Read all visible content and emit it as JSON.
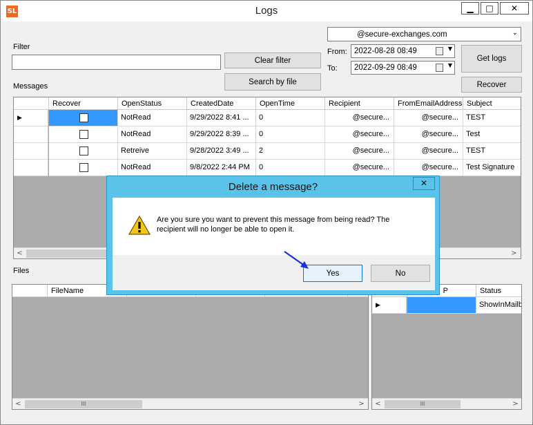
{
  "window": {
    "title": "Logs",
    "app_icon_text": "SL",
    "controls": {
      "minimize": "▁",
      "maximize": "□",
      "close": "✕"
    }
  },
  "filter": {
    "label": "Filter",
    "value": "",
    "clear_label": "Clear filter",
    "search_file_label": "Search by file"
  },
  "account": {
    "selected": "@secure-exchanges.com"
  },
  "dates": {
    "from_label": "From:",
    "from_value": "2022-08-28 08:49",
    "to_label": "To:",
    "to_value": "2022-09-29 08:49"
  },
  "actions": {
    "get_logs": "Get logs",
    "recover": "Recover"
  },
  "messages": {
    "label": "Messages",
    "columns": [
      "Recover",
      "OpenStatus",
      "CreatedDate",
      "OpenTime",
      "Recipient",
      "FromEmailAddress",
      "Subject"
    ],
    "rows": [
      {
        "current": true,
        "status": "NotRead",
        "created": "9/29/2022 8:41 ...",
        "opentime": "0",
        "recipient": "@secure...",
        "from": "@secure...",
        "subject": "TEST"
      },
      {
        "current": false,
        "status": "NotRead",
        "created": "9/29/2022 8:39 ...",
        "opentime": "0",
        "recipient": "@secure...",
        "from": "@secure...",
        "subject": "Test"
      },
      {
        "current": false,
        "status": "Retreive",
        "created": "9/28/2022 3:49 ...",
        "opentime": "2",
        "recipient": "@secure...",
        "from": "@secure...",
        "subject": "TEST"
      },
      {
        "current": false,
        "status": "NotRead",
        "created": "9/8/2022 2:44 PM",
        "opentime": "0",
        "recipient": "@secure...",
        "from": "@secure...",
        "subject": "Test Signature"
      }
    ]
  },
  "files": {
    "label": "Files",
    "columns": [
      "FileName"
    ]
  },
  "recipients": {
    "columns": [
      "P",
      "Status"
    ],
    "rows": [
      {
        "status": "ShowInMailb"
      }
    ]
  },
  "dialog": {
    "title": "Delete a message?",
    "close": "✕",
    "message": "Are you sure you want to prevent this message from being read? The recipient will no longer be able to open it.",
    "yes": "Yes",
    "no": "No"
  },
  "scrollbar": {
    "left": "<",
    "right": ">",
    "grip": "III"
  },
  "colors": {
    "dialog_frame": "#5ac3ea",
    "selection": "#3399ff",
    "grid_background": "#ababab",
    "annotation_arrow": "#1a2ee0"
  }
}
